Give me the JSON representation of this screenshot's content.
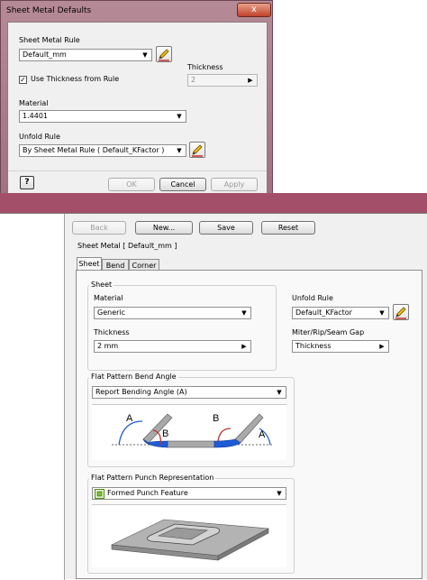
{
  "dialog": {
    "title": "Sheet Metal Defaults",
    "close_glyph": "x",
    "sheet_metal_rule_label": "Sheet Metal Rule",
    "sheet_metal_rule_value": "Default_mm",
    "use_thickness_label": "Use Thickness from Rule",
    "use_thickness_checked": true,
    "thickness_label": "Thickness",
    "thickness_value": "2",
    "material_label": "Material",
    "material_value": "1.4401",
    "unfold_rule_label": "Unfold Rule",
    "unfold_rule_value": "By Sheet Metal Rule ( Default_KFactor )",
    "help_label": "?",
    "ok_label": "OK",
    "cancel_label": "Cancel",
    "apply_label": "Apply"
  },
  "editor": {
    "toolbar": {
      "back": "Back",
      "new": "New...",
      "save": "Save",
      "reset": "Reset"
    },
    "standard_title": "Sheet Metal [ Default_mm ]",
    "tabs": [
      "Sheet",
      "Bend",
      "Corner"
    ],
    "sheet_group": {
      "title": "Sheet",
      "material_label": "Material",
      "material_value": "Generic",
      "thickness_label": "Thickness",
      "thickness_value": "2 mm"
    },
    "unfold_rule_label": "Unfold Rule",
    "unfold_rule_value": "Default_KFactor",
    "gap_label": "Miter/Rip/Seam Gap",
    "gap_value": "Thickness",
    "bend_angle_group": {
      "title": "Flat Pattern Bend Angle",
      "value": "Report Bending Angle (A)",
      "labels": {
        "a_left": "A",
        "b_left": "B",
        "b_right": "B",
        "a_right": "A"
      }
    },
    "punch_group": {
      "title": "Flat Pattern Punch Representation",
      "value": "Formed Punch Feature"
    }
  },
  "colors": {
    "dialog_frame": "#a97b89",
    "band": "#a34f6a",
    "bend_blue": "#1f5bd6",
    "bend_red": "#c0302c",
    "metal_gray": "#a9a9a9"
  }
}
